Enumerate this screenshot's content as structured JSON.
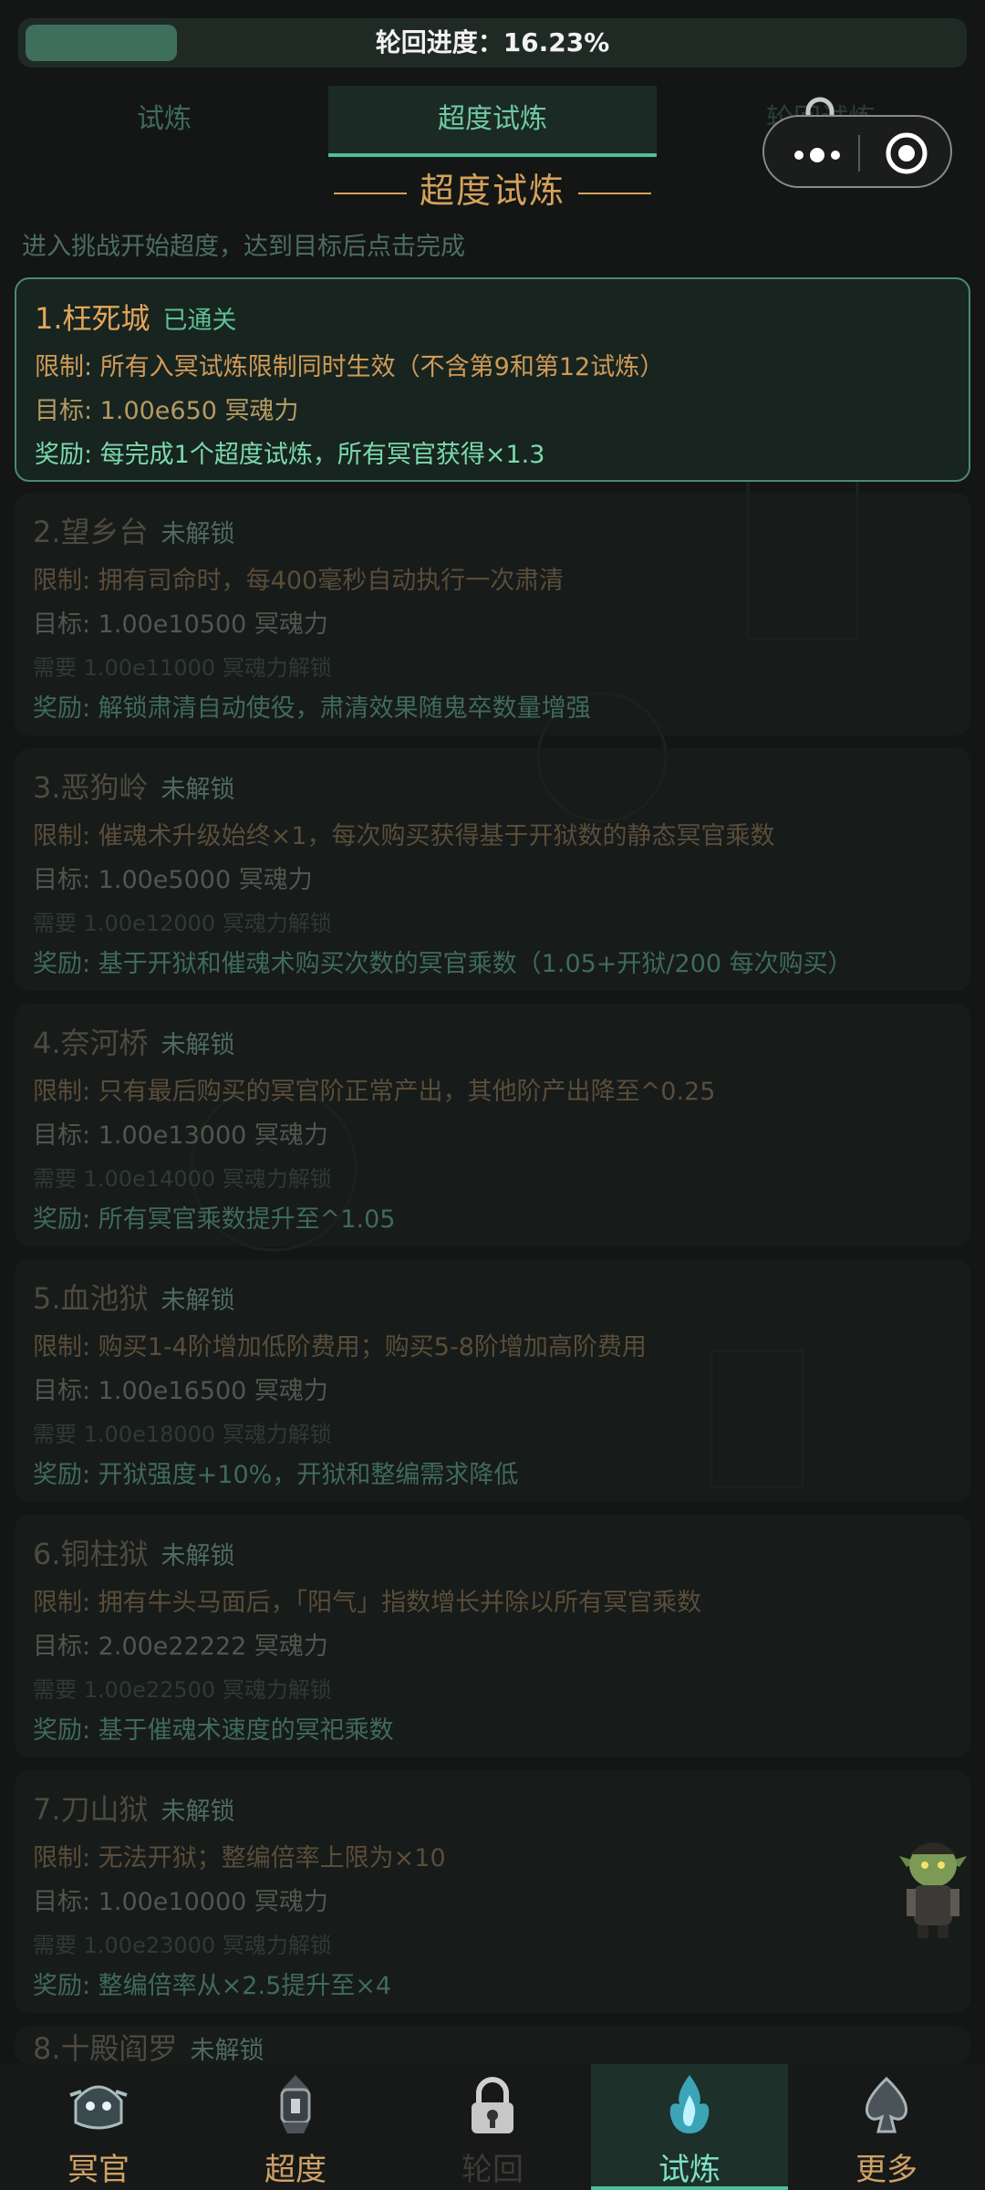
{
  "progress": {
    "label": "轮回进度：16.23%",
    "value": 0.1623
  },
  "tabs": [
    {
      "label": "试炼",
      "active": false
    },
    {
      "label": "超度试炼",
      "active": true
    },
    {
      "label": "轮回试炼",
      "active": false
    }
  ],
  "section_title": "超度试炼",
  "intro": "进入挑战开始超度，达到目标后点击完成",
  "trials": [
    {
      "title": "1.枉死城",
      "status": "已通关",
      "limit": "限制: 所有入冥试炼限制同时生效（不含第9和第12试炼）",
      "target": "目标: 1.00e650 冥魂力",
      "reward": "奖励: 每完成1个超度试炼，所有冥官获得×1.3"
    },
    {
      "title": "2.望乡台",
      "status": "未解锁",
      "limit": "限制: 拥有司命时，每400毫秒自动执行一次肃清",
      "target": "目标: 1.00e10500 冥魂力",
      "need": "需要 1.00e11000 冥魂力解锁",
      "reward": "奖励: 解锁肃清自动使役，肃清效果随鬼卒数量增强"
    },
    {
      "title": "3.恶狗岭",
      "status": "未解锁",
      "limit": "限制: 催魂术升级始终×1，每次购买获得基于开狱数的静态冥官乘数",
      "target": "目标: 1.00e5000 冥魂力",
      "need": "需要 1.00e12000 冥魂力解锁",
      "reward": "奖励: 基于开狱和催魂术购买次数的冥官乘数（1.05+开狱/200 每次购买）"
    },
    {
      "title": "4.奈河桥",
      "status": "未解锁",
      "limit": "限制: 只有最后购买的冥官阶正常产出，其他阶产出降至^0.25",
      "target": "目标: 1.00e13000 冥魂力",
      "need": "需要 1.00e14000 冥魂力解锁",
      "reward": "奖励: 所有冥官乘数提升至^1.05"
    },
    {
      "title": "5.血池狱",
      "status": "未解锁",
      "limit": "限制: 购买1-4阶增加低阶费用；购买5-8阶增加高阶费用",
      "target": "目标: 1.00e16500 冥魂力",
      "need": "需要 1.00e18000 冥魂力解锁",
      "reward": "奖励: 开狱强度+10%，开狱和整编需求降低"
    },
    {
      "title": "6.铜柱狱",
      "status": "未解锁",
      "limit": "限制: 拥有牛头马面后，「阳气」指数增长并除以所有冥官乘数",
      "target": "目标: 2.00e22222 冥魂力",
      "need": "需要 1.00e22500 冥魂力解锁",
      "reward": "奖励: 基于催魂术速度的冥祀乘数"
    },
    {
      "title": "7.刀山狱",
      "status": "未解锁",
      "limit": "限制: 无法开狱；整编倍率上限为×10",
      "target": "目标: 1.00e10000 冥魂力",
      "need": "需要 1.00e23000 冥魂力解锁",
      "reward": "奖励: 整编倍率从×2.5提升至×4"
    },
    {
      "title": "8.十殿阎罗",
      "status": "未解锁"
    }
  ],
  "nav": [
    {
      "label": "冥官",
      "icon": "ghost-official-icon"
    },
    {
      "label": "超度",
      "icon": "lantern-icon"
    },
    {
      "label": "轮回",
      "icon": "lock-icon",
      "disabled": true
    },
    {
      "label": "试炼",
      "icon": "blue-flame-icon",
      "selected": true
    },
    {
      "label": "更多",
      "icon": "spade-icon"
    }
  ]
}
